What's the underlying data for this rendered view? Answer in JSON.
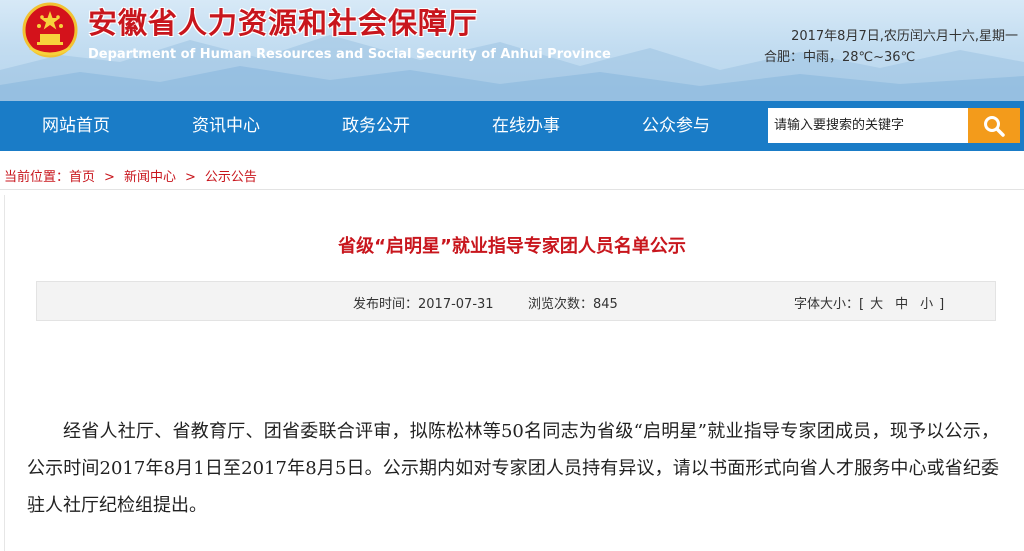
{
  "header": {
    "title": "安徽省人力资源和社会保障厅",
    "subtitle": "Department of Human Resources and Social Security of Anhui Province",
    "date": "2017年8月7日,农历闰六月十六,星期一",
    "weather": "合肥：中雨，28℃~36℃"
  },
  "nav": {
    "items": [
      "网站首页",
      "资讯中心",
      "政务公开",
      "在线办事",
      "公众参与"
    ],
    "search_placeholder": "请输入要搜索的关键字"
  },
  "breadcrumb": {
    "prefix": "当前位置：",
    "items": [
      "首页",
      "新闻中心",
      "公示公告"
    ],
    "separator": ">"
  },
  "article": {
    "title": "省级“启明星”就业指导专家团人员名单公示",
    "publish_label": "发布时间：2017-07-31",
    "views_label": "浏览次数：845",
    "font_size_label": "字体大小：[",
    "font_size_options": [
      "大",
      "中",
      "小"
    ],
    "font_size_close": "]",
    "body": "经省人社厅、省教育厅、团省委联合评审，拟陈松林等50名同志为省级“启明星”就业指导专家团成员，现予以公示，公示时间2017年8月1日至2017年8月5日。公示期内如对专家团人员持有异议，请以书面形式向省人才服务中心或省纪委驻人社厅纪检组提出。"
  },
  "colors": {
    "brand_red": "#c8161d",
    "nav_blue": "#1a7cc7",
    "search_orange": "#f39b1b"
  },
  "icons": {
    "emblem": "national-emblem-icon",
    "search": "search-icon"
  }
}
